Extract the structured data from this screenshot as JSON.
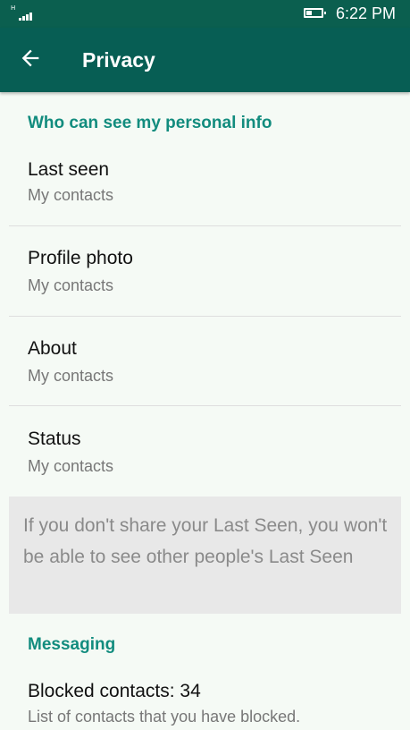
{
  "status_bar": {
    "network": "H",
    "signal_bars": 4,
    "battery_level": 0.4,
    "time": "6:22 PM"
  },
  "app_bar": {
    "title": "Privacy",
    "back_icon": "arrow-left-icon"
  },
  "personal_info": {
    "header": "Who can see my personal info",
    "items": [
      {
        "label": "Last seen",
        "value": "My contacts"
      },
      {
        "label": "Profile photo",
        "value": "My contacts"
      },
      {
        "label": "About",
        "value": "My contacts"
      },
      {
        "label": "Status",
        "value": "My contacts"
      }
    ]
  },
  "info_note": "If you don't share your Last Seen, you won't be able to see other people's Last Seen",
  "messaging": {
    "header": "Messaging",
    "blocked": {
      "label": "Blocked contacts: 34",
      "value": "List of contacts that you have blocked."
    }
  },
  "colors": {
    "status_bar": "#0b5f4f",
    "app_bar": "#075e54",
    "accent": "#128c7e",
    "background": "#f5faf5",
    "info_box": "#e8e8e8"
  }
}
